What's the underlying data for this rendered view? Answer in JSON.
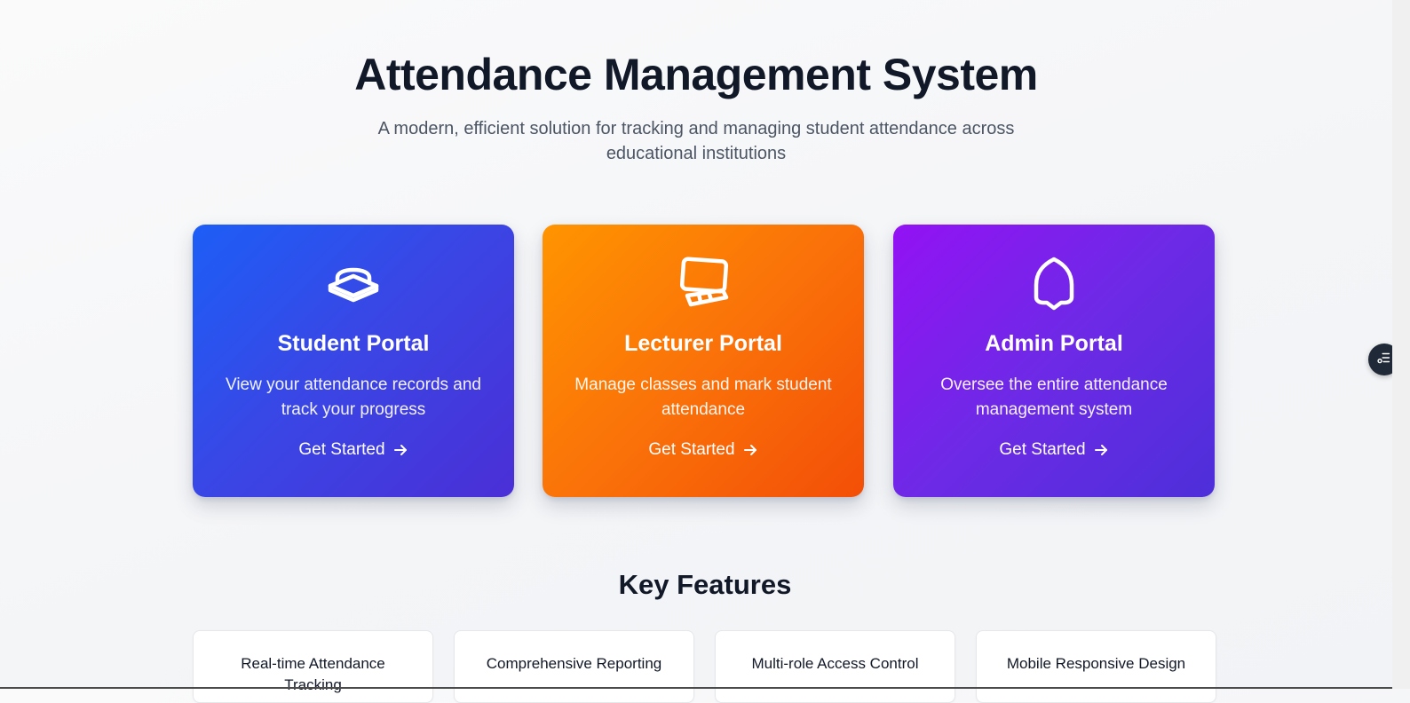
{
  "hero": {
    "title": "Attendance Management System",
    "subtitle": "A modern, efficient solution for tracking and managing student attendance across educational institutions"
  },
  "portals": [
    {
      "title": "Student Portal",
      "description": "View your attendance records and track your progress",
      "cta": "Get Started",
      "icon": "graduation-cap-icon",
      "gradient": [
        "#1d5ef6",
        "#4a2fd6"
      ]
    },
    {
      "title": "Lecturer Portal",
      "description": "Manage classes and mark student attendance",
      "cta": "Get Started",
      "icon": "presentation-board-icon",
      "gradient": [
        "#ff9400",
        "#f34f07"
      ]
    },
    {
      "title": "Admin Portal",
      "description": "Oversee the entire attendance management system",
      "cta": "Get Started",
      "icon": "shield-icon",
      "gradient": [
        "#9312f4",
        "#4d2fd9"
      ]
    }
  ],
  "features": {
    "title": "Key Features",
    "items": [
      {
        "label": "Real-time Attendance Tracking"
      },
      {
        "label": "Comprehensive Reporting"
      },
      {
        "label": "Multi-role Access Control"
      },
      {
        "label": "Mobile Responsive Design"
      }
    ]
  },
  "floating_button": {
    "icon": "list-menu-icon",
    "color": "#1f2937"
  }
}
